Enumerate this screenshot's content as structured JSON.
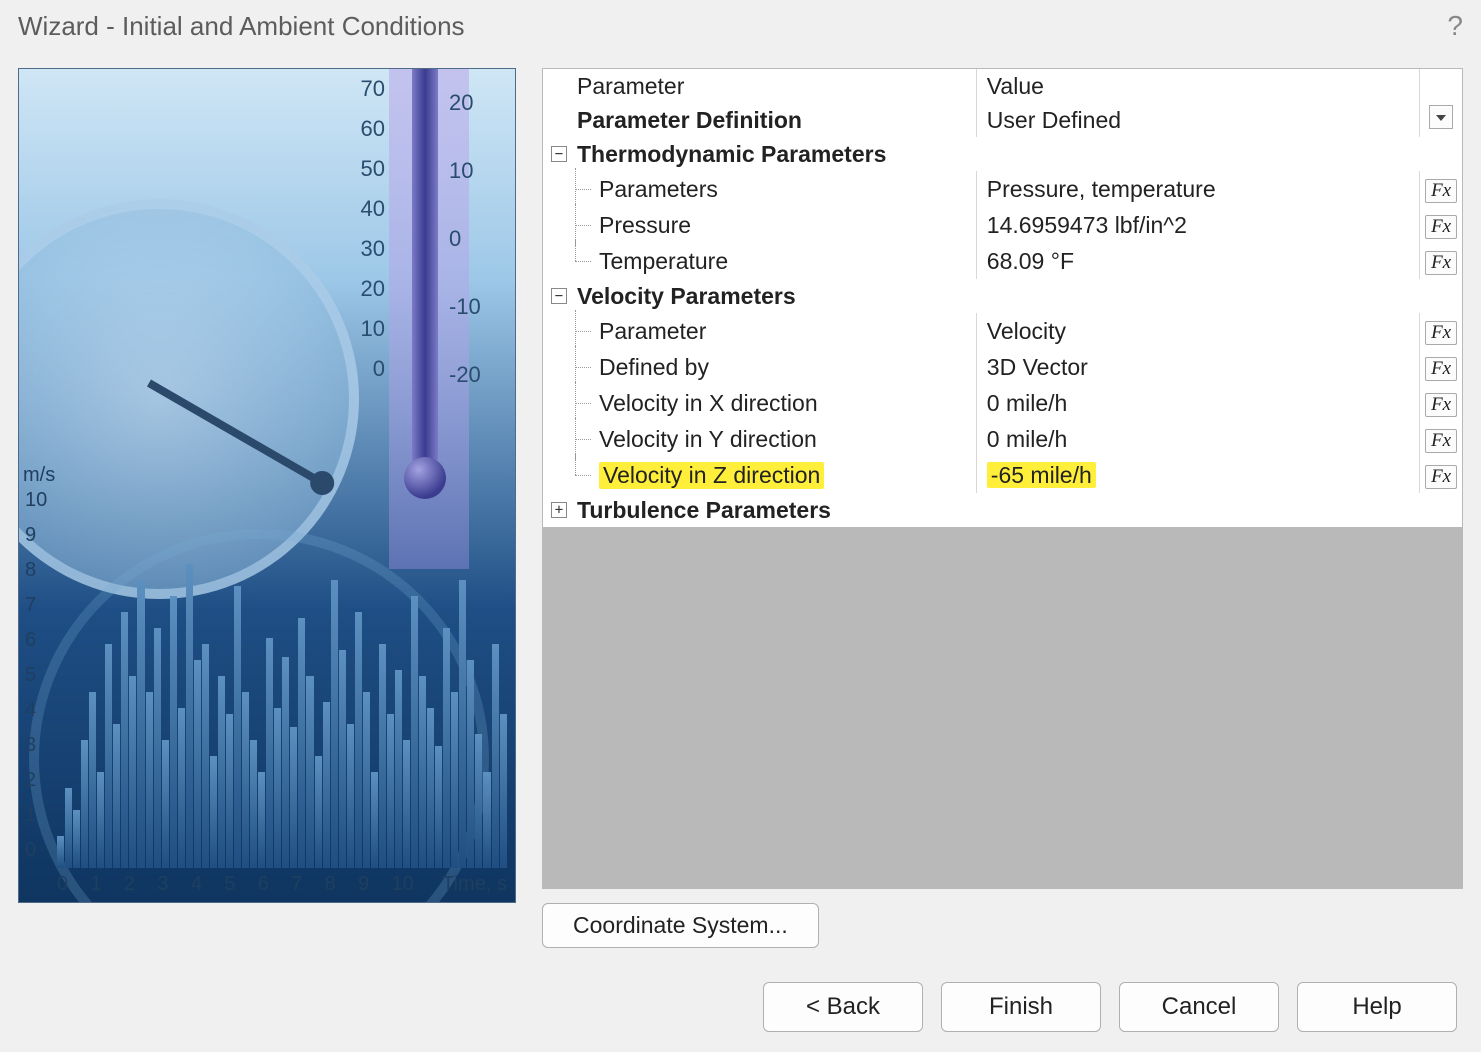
{
  "window": {
    "title": "Wizard - Initial and Ambient Conditions"
  },
  "illustration": {
    "y_unit": "m/s",
    "x_unit": "Time, s",
    "y_ticks": [
      "10",
      "9",
      "8",
      "7",
      "6",
      "5",
      "4",
      "3",
      "2",
      "1",
      "0"
    ],
    "x_ticks": [
      "0",
      "1",
      "2",
      "3",
      "4",
      "5",
      "6",
      "7",
      "8",
      "9",
      "10"
    ],
    "thermo_left": [
      "70",
      "60",
      "50",
      "40",
      "30",
      "20",
      "10",
      "0"
    ],
    "thermo_right": [
      "20",
      "10",
      "0",
      "-10",
      "-20"
    ]
  },
  "grid": {
    "headers": {
      "param": "Parameter",
      "value": "Value"
    },
    "definition": {
      "label": "Parameter Definition",
      "value": "User Defined"
    },
    "sections": [
      {
        "title": "Thermodynamic Parameters",
        "expanded": true,
        "rows": [
          {
            "label": "Parameters",
            "value": "Pressure, temperature",
            "fx": true
          },
          {
            "label": "Pressure",
            "value": "14.6959473 lbf/in^2",
            "fx": true
          },
          {
            "label": "Temperature",
            "value": "68.09 °F",
            "fx": true
          }
        ]
      },
      {
        "title": "Velocity Parameters",
        "expanded": true,
        "rows": [
          {
            "label": "Parameter",
            "value": "Velocity",
            "fx": true
          },
          {
            "label": "Defined by",
            "value": "3D Vector",
            "fx": true
          },
          {
            "label": "Velocity in X direction",
            "value": "0 mile/h",
            "fx": true
          },
          {
            "label": "Velocity in Y direction",
            "value": "0 mile/h",
            "fx": true
          },
          {
            "label": "Velocity in Z direction",
            "value": "-65 mile/h",
            "fx": true,
            "highlight": true
          }
        ]
      },
      {
        "title": "Turbulence Parameters",
        "expanded": false,
        "rows": []
      }
    ]
  },
  "buttons": {
    "coord": "Coordinate System...",
    "back": "< Back",
    "finish": "Finish",
    "cancel": "Cancel",
    "help": "Help",
    "fx": "Fx"
  }
}
